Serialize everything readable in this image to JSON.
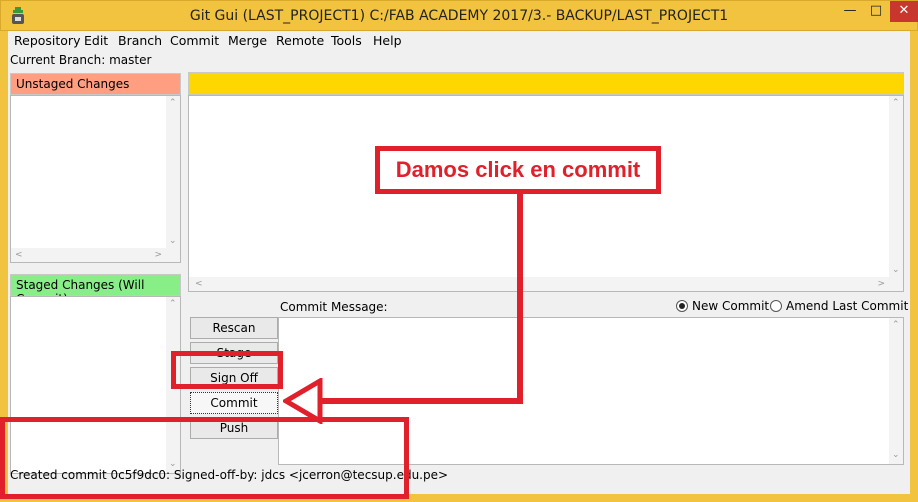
{
  "window": {
    "title": "Git Gui (LAST_PROJECT1) C:/FAB ACADEMY 2017/3.- BACKUP/LAST_PROJECT1",
    "minimize": "—",
    "maximize": "□",
    "close": "✕"
  },
  "menu": [
    "Repository",
    "Edit",
    "Branch",
    "Commit",
    "Merge",
    "Remote",
    "Tools",
    "Help"
  ],
  "branch": "Current Branch: master",
  "unstaged": {
    "label": "Unstaged Changes"
  },
  "staged": {
    "label": "Staged Changes (Will Commit)"
  },
  "commit": {
    "message_label": "Commit Message:",
    "radio_new": "New Commit",
    "radio_amend": "Amend Last Commit",
    "new_selected": true
  },
  "buttons": {
    "rescan": "Rescan",
    "stage_changed": "Stage Changed",
    "sign_off": "Sign Off",
    "commit": "Commit",
    "push": "Push"
  },
  "status": "Created commit 0c5f9dc0: Signed-off-by: jdcs <jcerron@tecsup.edu.pe>",
  "annotation": {
    "callout": "Damos click en commit",
    "color": "#e0202a"
  },
  "colors": {
    "titlebar": "#f2c33f",
    "unstaged": "#ff9e80",
    "staged": "#88ee88",
    "diff_header": "#ffd700"
  }
}
